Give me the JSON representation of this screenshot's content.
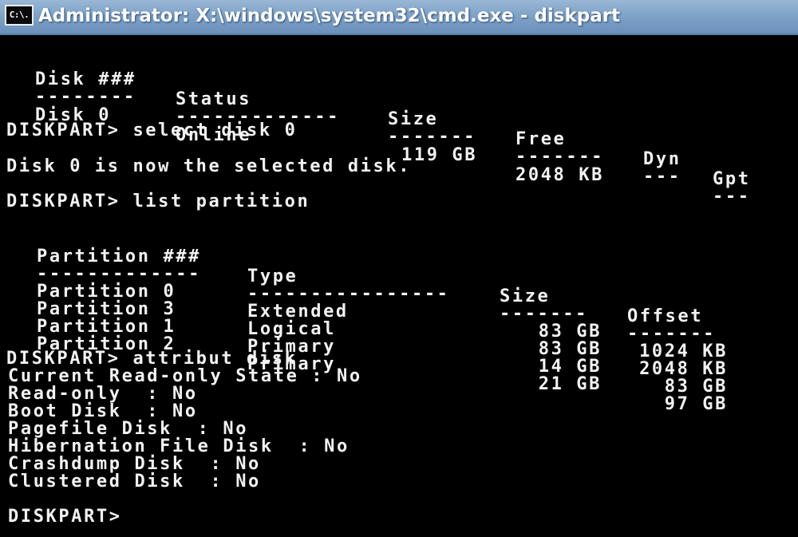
{
  "window": {
    "title": "Administrator: X:\\windows\\system32\\cmd.exe - diskpart",
    "icon_label": "C:\\."
  },
  "disk_table": {
    "headers": [
      "Disk ###",
      "Status",
      "Size",
      "Free",
      "Dyn",
      "Gpt"
    ],
    "separators": [
      "--------",
      "-------------",
      "-------",
      "-------",
      "---",
      "---"
    ],
    "rows": [
      [
        "Disk 0",
        "Online",
        "119 GB",
        "2048 KB",
        "",
        ""
      ]
    ]
  },
  "commands": {
    "select": "DISKPART> select disk 0",
    "select_result": "Disk 0 is now the selected disk.",
    "list": "DISKPART> list partition",
    "attribut": "DISKPART> attribut disk",
    "prompt": "DISKPART>"
  },
  "partition_table": {
    "headers": [
      "Partition ###",
      "Type",
      "Size",
      "Offset"
    ],
    "separators": [
      "-------------",
      "----------------",
      "-------",
      "-------"
    ],
    "rows": [
      [
        "Partition 0",
        "Extended",
        "83 GB",
        "1024 KB"
      ],
      [
        "Partition 3",
        "Logical",
        "83 GB",
        "2048 KB"
      ],
      [
        "Partition 1",
        "Primary",
        "14 GB",
        "83 GB"
      ],
      [
        "Partition 2",
        "Primary",
        "21 GB",
        "97 GB"
      ]
    ]
  },
  "attributes": [
    "Current Read-only State : No",
    "Read-only  : No",
    "Boot Disk  : No",
    "Pagefile Disk  : No",
    "Hibernation File Disk  : No",
    "Crashdump Disk  : No",
    "Clustered Disk  : No"
  ]
}
